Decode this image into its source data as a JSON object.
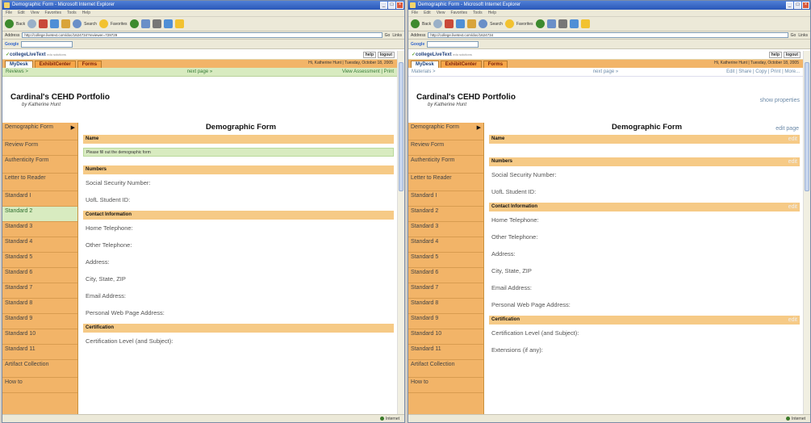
{
  "left": {
    "window_title": "Demographic Form - Microsoft Internet Explorer",
    "menu": [
      "File",
      "Edit",
      "View",
      "Favorites",
      "Tools",
      "Help"
    ],
    "toolbar": {
      "back": "Back",
      "search": "Search",
      "favorites": "Favorites"
    },
    "address_label": "Address",
    "address": "http://college.livetext.com/doc/1624734?reviewer=729729",
    "go_label": "Go",
    "links_label": "Links",
    "google_label": "Google",
    "site": {
      "logo": "collegeLiveText",
      "logo_sub": "edu solutions",
      "help": "help",
      "logout": "logout"
    },
    "tabs": [
      {
        "label": "MyDesk",
        "active": true
      },
      {
        "label": "ExhibitCenter",
        "active": false
      },
      {
        "label": "Forms",
        "active": false
      }
    ],
    "greeting": "Hi, Katherine Hunt | Tuesday, October 18, 2005",
    "subnav": {
      "left": "Reviews >",
      "center": "next page »",
      "right": "View Assessment | Print"
    },
    "portfolio_title": "Cardinal's CEHD Portfolio",
    "portfolio_by": "by Katherine Hunt",
    "sidebar": [
      {
        "label": "Demographic Form",
        "selected": false,
        "arrow": true
      },
      {
        "label": "Review Form",
        "selected": false
      },
      {
        "label": "Authenticity Form",
        "selected": false
      },
      {
        "label": "Letter to Reader",
        "selected": false
      },
      {
        "label": "Standard I",
        "selected": false
      },
      {
        "label": "Standard 2",
        "selected": true
      },
      {
        "label": "Standard 3",
        "selected": false
      },
      {
        "label": "Standard 4",
        "selected": false
      },
      {
        "label": "Standard 5",
        "selected": false
      },
      {
        "label": "Standard 6",
        "selected": false
      },
      {
        "label": "Standard 7",
        "selected": false
      },
      {
        "label": "Standard 8",
        "selected": false
      },
      {
        "label": "Standard 9",
        "selected": false
      },
      {
        "label": "Standard 10",
        "selected": false
      },
      {
        "label": "Standard 11",
        "selected": false
      },
      {
        "label": "Artifact Collection",
        "selected": false
      },
      {
        "label": "How to",
        "selected": false
      }
    ],
    "form_title": "Demographic Form",
    "sections": {
      "name": "Name",
      "name_info": "Please fill out the demographic form",
      "numbers": "Numbers",
      "ssn": "Social Security Number:",
      "student_id": "UofL Student ID:",
      "contact": "Contact Information",
      "home_tel": "Home Telephone:",
      "other_tel": "Other Telephone:",
      "address": "Address:",
      "city": "City, State, ZIP",
      "email": "Email Address:",
      "web": "Personal Web Page Address:",
      "certification": "Certification",
      "cert_level": "Certification Level (and Subject):"
    },
    "status": "Internet"
  },
  "right": {
    "window_title": "Demographic Form - Microsoft Internet Explorer",
    "menu": [
      "File",
      "Edit",
      "View",
      "Favorites",
      "Tools",
      "Help"
    ],
    "toolbar": {
      "back": "Back",
      "search": "Search",
      "favorites": "Favorites"
    },
    "address_label": "Address",
    "address": "http://college.livetext.com/doc/1624734",
    "go_label": "Go",
    "links_label": "Links",
    "google_label": "Google",
    "site": {
      "logo": "collegeLiveText",
      "logo_sub": "edu solutions",
      "help": "help",
      "logout": "logout"
    },
    "tabs": [
      {
        "label": "MyDesk",
        "active": true
      },
      {
        "label": "ExhibitCenter",
        "active": false
      },
      {
        "label": "Forms",
        "active": false
      }
    ],
    "greeting": "Hi, Katherine Hunt | Tuesday, October 18, 2005",
    "subnav": {
      "left": "Materials >",
      "center": "next page »",
      "right": "Edit | Share | Copy | Print | More..."
    },
    "portfolio_title": "Cardinal's CEHD Portfolio",
    "portfolio_by": "by Katherine Hunt",
    "show_properties": "show properties",
    "sidebar": [
      {
        "label": "Demographic Form",
        "selected": false,
        "arrow": true
      },
      {
        "label": "Review Form",
        "selected": false
      },
      {
        "label": "Authenticity Form",
        "selected": false
      },
      {
        "label": "Letter to Reader",
        "selected": false
      },
      {
        "label": "Standard I",
        "selected": false
      },
      {
        "label": "Standard 2",
        "selected": false
      },
      {
        "label": "Standard 3",
        "selected": false
      },
      {
        "label": "Standard 4",
        "selected": false
      },
      {
        "label": "Standard 5",
        "selected": false
      },
      {
        "label": "Standard 6",
        "selected": false
      },
      {
        "label": "Standard 7",
        "selected": false
      },
      {
        "label": "Standard 8",
        "selected": false
      },
      {
        "label": "Standard 9",
        "selected": false
      },
      {
        "label": "Standard 10",
        "selected": false
      },
      {
        "label": "Standard 11",
        "selected": false
      },
      {
        "label": "Artifact Collection",
        "selected": false
      },
      {
        "label": "How to",
        "selected": false
      }
    ],
    "form_title": "Demographic Form",
    "edit_page": "edit page",
    "edit": "edit",
    "sections": {
      "name": "Name",
      "numbers": "Numbers",
      "ssn": "Social Security Number:",
      "student_id": "UofL Student ID:",
      "contact": "Contact Information",
      "home_tel": "Home Telephone:",
      "other_tel": "Other Telephone:",
      "address": "Address:",
      "city": "City, State, ZIP",
      "email": "Email Address:",
      "web": "Personal Web Page Address:",
      "certification": "Certification",
      "cert_level": "Certification Level (and Subject):",
      "extensions": "Extensions (if any):"
    },
    "status": "Internet"
  },
  "colors": {
    "orange": "#f2b468",
    "green": "#d8ebc0",
    "section": "#f6ca86",
    "link": "#6c8aa8"
  }
}
